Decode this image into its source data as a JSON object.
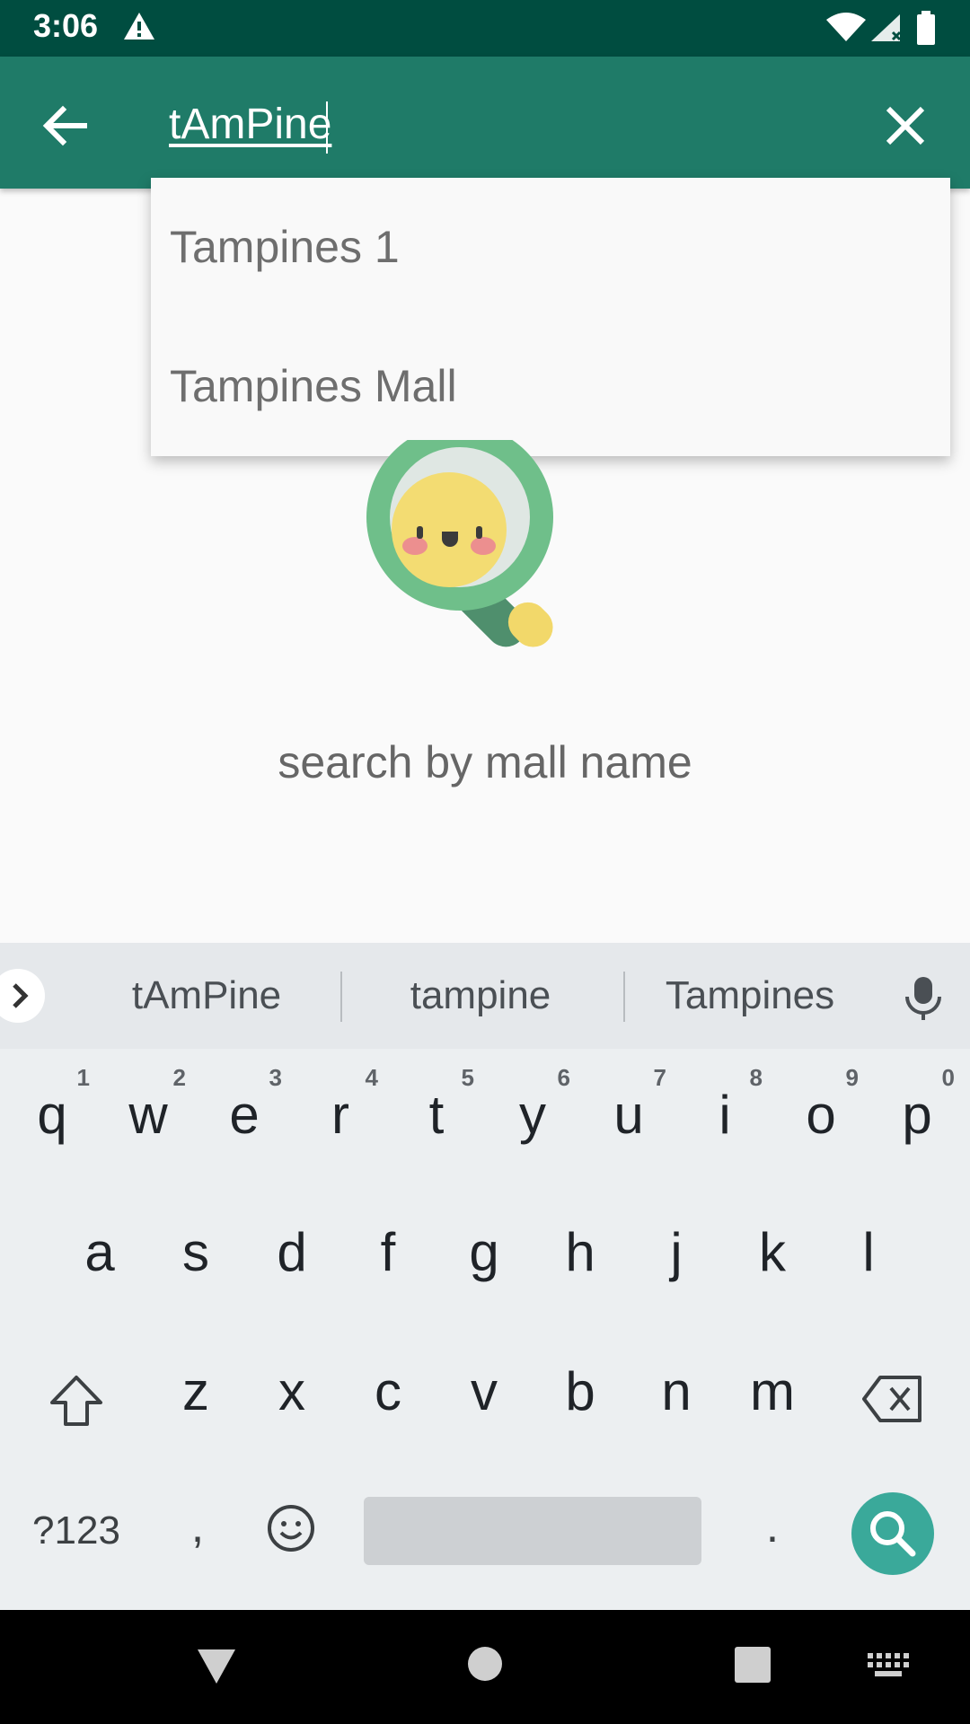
{
  "status_bar": {
    "time": "3:06"
  },
  "search": {
    "value": "tAmPine"
  },
  "suggestions": [
    "Tampines 1",
    "Tampines Mall"
  ],
  "empty_state": {
    "hint": "search by mall name"
  },
  "keyboard": {
    "suggestion_strip": [
      "tAmPine",
      "tampine",
      "Tampines"
    ],
    "row1": [
      {
        "key": "q",
        "hint": "1"
      },
      {
        "key": "w",
        "hint": "2"
      },
      {
        "key": "e",
        "hint": "3"
      },
      {
        "key": "r",
        "hint": "4"
      },
      {
        "key": "t",
        "hint": "5"
      },
      {
        "key": "y",
        "hint": "6"
      },
      {
        "key": "u",
        "hint": "7"
      },
      {
        "key": "i",
        "hint": "8"
      },
      {
        "key": "o",
        "hint": "9"
      },
      {
        "key": "p",
        "hint": "0"
      }
    ],
    "row2": [
      "a",
      "s",
      "d",
      "f",
      "g",
      "h",
      "j",
      "k",
      "l"
    ],
    "row3": [
      "z",
      "x",
      "c",
      "v",
      "b",
      "n",
      "m"
    ],
    "symbols_label": "?123",
    "comma": ",",
    "period": "."
  },
  "colors": {
    "status_bar": "#004d40",
    "app_bar": "#1f7b68",
    "search_key": "#3aa99a"
  },
  "icons": {
    "back": "arrow-left-icon",
    "clear": "close-icon",
    "mic": "microphone-icon",
    "shift": "shift-icon",
    "backspace": "backspace-icon",
    "emoji": "emoji-icon",
    "search": "search-icon"
  }
}
